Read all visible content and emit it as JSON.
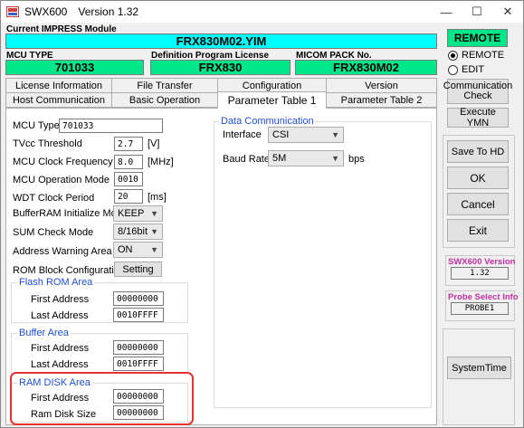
{
  "window": {
    "app_name": "SWX600",
    "version_label": "Version  1.32",
    "controls": {
      "minimize": "—",
      "maximize": "☐",
      "close": "✕"
    }
  },
  "module": {
    "heading": "Current IMPRESS Module",
    "name": "FRX830M02.YIM",
    "mcu_type_label": "MCU TYPE",
    "mcu_type": "701033",
    "def_license_label": "Definition Program License",
    "def_license": "FRX830",
    "micom_pack_label": "MICOM PACK No.",
    "micom_pack": "FRX830M02"
  },
  "tabs_row1": [
    "License Information",
    "File Transfer",
    "Configuration",
    "Version"
  ],
  "tabs_row2": [
    "Host Communication",
    "Basic Operation",
    "Parameter Table 1",
    "Parameter Table 2"
  ],
  "active_tab": "Parameter Table 1",
  "params": {
    "mcu_type_label": "MCU Type",
    "mcu_type_value": "701033",
    "tvcc_label": "TVcc Threshold",
    "tvcc_value": "2.7",
    "tvcc_unit": "[V]",
    "clock_label": "MCU Clock Frequency",
    "clock_value": "8.0",
    "clock_unit": "[MHz]",
    "mode_label": "MCU Operation Mode",
    "mode_value": "0010",
    "wdt_label": "WDT Clock Period",
    "wdt_value": "20",
    "wdt_unit": "[ms]",
    "bufferram_label": "BufferRAM Initialize Mode",
    "bufferram_value": "KEEP",
    "sum_label": "SUM Check Mode",
    "sum_value": "8/16bit",
    "addr_warn_label": "Address Warning Area",
    "addr_warn_value": "ON",
    "rom_block_label": "ROM Block Configuration",
    "rom_block_button": "Setting",
    "flash_title": "Flash ROM Area",
    "flash_first_label": "First Address",
    "flash_first_value": "00000000",
    "flash_last_label": "Last Address",
    "flash_last_value": "0010FFFF",
    "buffer_title": "Buffer Area",
    "buffer_first_label": "First  Address",
    "buffer_first_value": "00000000",
    "buffer_last_label": "Last  Address",
    "buffer_last_value": "0010FFFF",
    "ramdisk_title": "RAM DISK Area",
    "ramdisk_first_label": "First  Address",
    "ramdisk_first_value": "00000000",
    "ramdisk_size_label": "Ram Disk Size",
    "ramdisk_size_value": "00000000"
  },
  "datacomm": {
    "title": "Data Communication",
    "interface_label": "Interface",
    "interface_value": "CSI",
    "baud_label": "Baud Rate",
    "baud_value": "5M",
    "baud_unit": "bps"
  },
  "right": {
    "remote_heading": "REMOTE",
    "radio_remote": "REMOTE",
    "radio_edit": "EDIT",
    "selected_mode": "REMOTE",
    "comm_check": "Communication Check",
    "execute_ymn": "Execute YMN",
    "save_to_hd": "Save To HD",
    "ok": "OK",
    "cancel": "Cancel",
    "exit": "Exit",
    "swx_version_title": "SWX600 Version",
    "swx_version_value": "1.32",
    "probe_info_title": "Probe Select Info",
    "probe_info_value": "PROBE1",
    "system_time": "SystemTime"
  },
  "colors": {
    "cyan": "#00ffff",
    "green": "#00e68a",
    "group_title": "#1f4fd0",
    "highlight_red": "#e83030",
    "info_title": "#c030a0"
  }
}
